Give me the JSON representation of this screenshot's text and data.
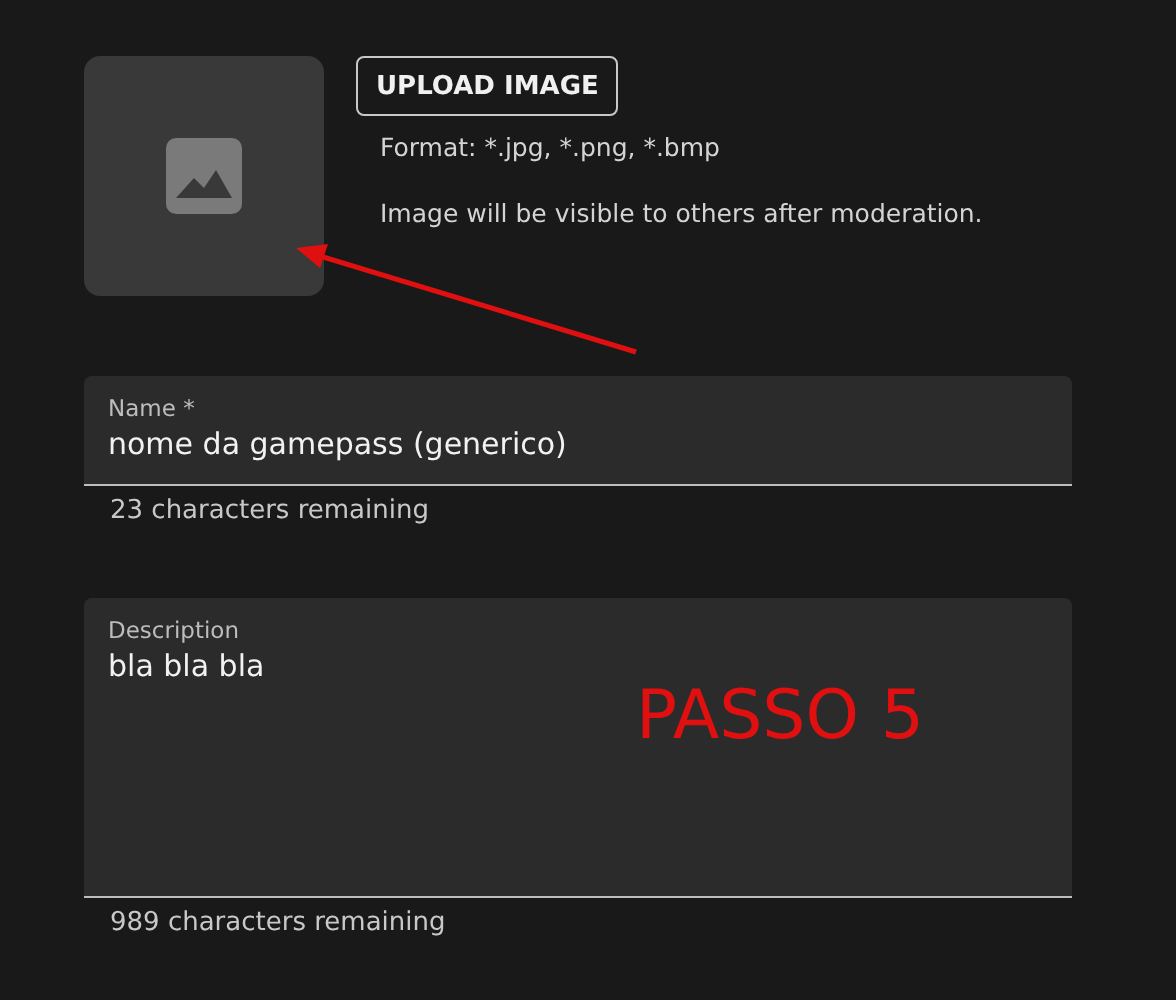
{
  "upload": {
    "button": "UPLOAD IMAGE",
    "format": "Format: *.jpg, *.png, *.bmp",
    "note": "Image will be visible to others after moderation."
  },
  "fields": [
    {
      "kind": "single",
      "label": "Name",
      "required_mark": "*",
      "value": "nome da gamepass (generico)",
      "helper": "23 characters remaining"
    },
    {
      "kind": "multi",
      "label": "Description",
      "value": "bla bla bla",
      "helper": "989 characters remaining"
    }
  ],
  "annotation": {
    "text": "PASSO 5"
  }
}
